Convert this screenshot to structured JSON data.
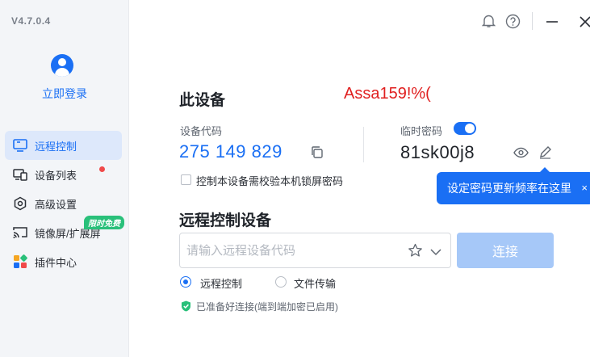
{
  "app": {
    "version": "V4.7.0.4"
  },
  "sidebar": {
    "login_label": "立即登录",
    "items": [
      {
        "label": "远程控制",
        "icon": "monitor-icon",
        "active": true
      },
      {
        "label": "设备列表",
        "icon": "devices-icon",
        "badge_dot": true
      },
      {
        "label": "高级设置",
        "icon": "settings-hexagon-icon"
      },
      {
        "label": "镜像屏/扩展屏",
        "icon": "cast-screen-icon",
        "badge": "限时免费"
      },
      {
        "label": "插件中心",
        "icon": "plugin-grid-icon"
      }
    ]
  },
  "header": {
    "icons": [
      "bell-icon",
      "help-icon",
      "minimize-icon",
      "close-icon"
    ]
  },
  "device": {
    "title": "此设备",
    "note": "Assa159!%(",
    "code_label": "设备代码",
    "code": "275 149 829",
    "temp_pass_label": "临时密码",
    "temp_pass": "81sk00j8",
    "temp_pass_enabled": true,
    "lock_checkbox_label": "控制本设备需校验本机锁屏密码",
    "lock_checkbox_checked": false
  },
  "tooltip": {
    "text": "设定密码更新频率在这里",
    "close": "×"
  },
  "remote": {
    "title": "远程控制设备",
    "input_placeholder": "请输入远程设备代码",
    "input_value": "",
    "connect_label": "连接",
    "modes": [
      {
        "label": "远程控制",
        "selected": true
      },
      {
        "label": "文件传输",
        "selected": false
      }
    ],
    "status": "已准备好连接(端到端加密已启用)"
  },
  "colors": {
    "accent": "#1a6ff4",
    "connect_disabled": "#a6c8f8",
    "red_note": "#e02020",
    "success": "#29c07a"
  }
}
